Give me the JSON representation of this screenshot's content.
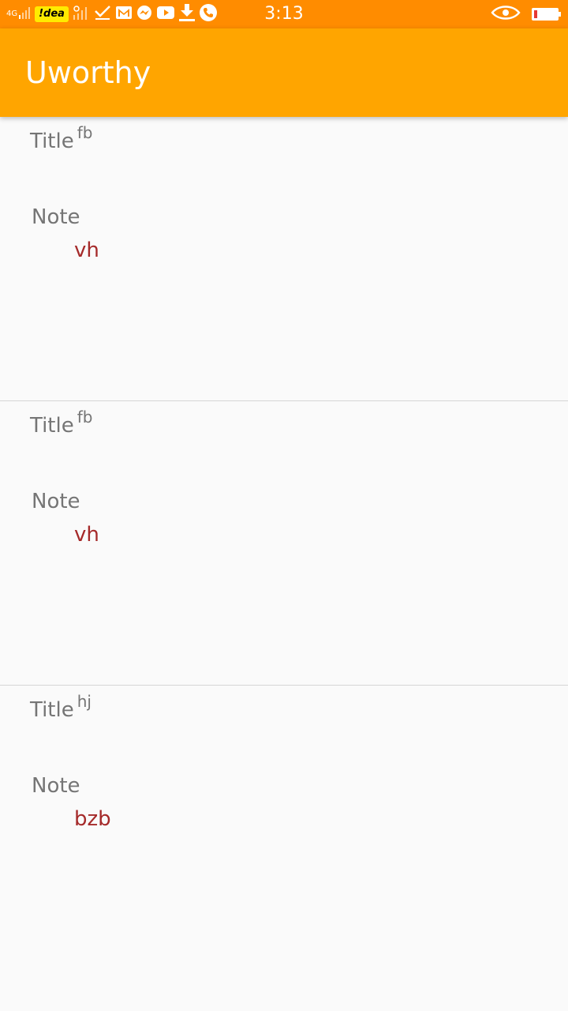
{
  "status_bar": {
    "network": "4G",
    "carrier": "!dea",
    "time": "3:13",
    "icons_left": [
      "signal-icon",
      "carrier-badge",
      "signal-2-icon",
      "check-icon",
      "gmail-icon",
      "messenger-icon",
      "youtube-icon",
      "download-icon",
      "phone-icon"
    ],
    "icons_right": [
      "eye-icon",
      "battery-icon"
    ],
    "battery_level": 0.15
  },
  "app_bar": {
    "title": "Uworthy"
  },
  "notes": [
    {
      "title_label": "Title",
      "title_value": "fb",
      "note_label": "Note",
      "note_value": "vh"
    },
    {
      "title_label": "Title",
      "title_value": "fb",
      "note_label": "Note",
      "note_value": "vh"
    },
    {
      "title_label": "Title",
      "title_value": "hj",
      "note_label": "Note",
      "note_value": "bzb"
    }
  ],
  "colors": {
    "status_bar": "#ff8c00",
    "app_bar": "#ffa500",
    "label_text": "#757575",
    "value_text": "#a52a2a",
    "background": "#fafafa"
  }
}
